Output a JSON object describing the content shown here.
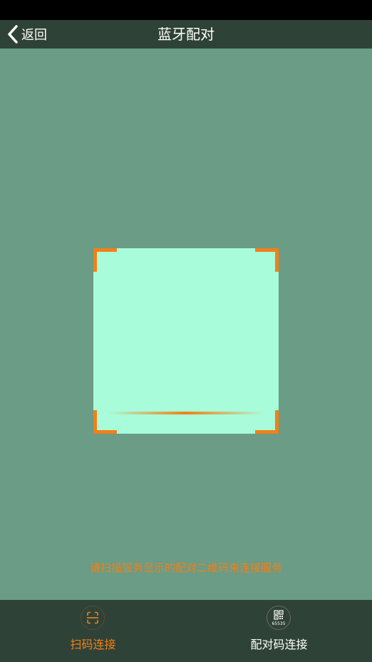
{
  "nav": {
    "back_label": "返回",
    "title": "蓝牙配对"
  },
  "scanner": {
    "hint": "请扫描服务显示的配对二维码来连接服务"
  },
  "bottom_tabs": {
    "scan": {
      "label": "扫码连接",
      "icon": "scan-icon",
      "active": true
    },
    "pair": {
      "label": "配对码连接",
      "icon": "qr-code-icon",
      "icon_text": "65535",
      "active": false
    }
  },
  "colors": {
    "accent": "#f28018",
    "nav_background": "#2f4237",
    "page_background": "#6a9c86",
    "frame_background": "#a8fcd9",
    "status_bar": "#000000"
  }
}
